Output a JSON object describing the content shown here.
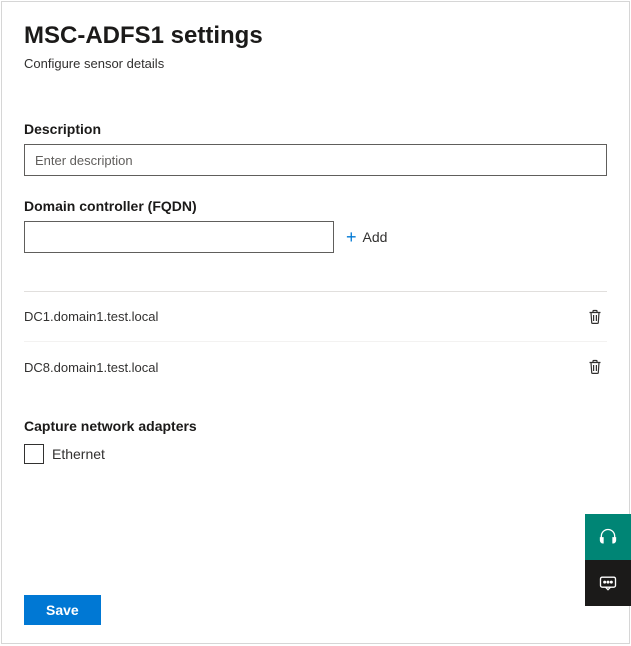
{
  "header": {
    "title": "MSC-ADFS1 settings",
    "subtitle": "Configure sensor details"
  },
  "description": {
    "label": "Description",
    "placeholder": "Enter description",
    "value": ""
  },
  "fqdn": {
    "label": "Domain controller (FQDN)",
    "value": "",
    "add_label": "Add"
  },
  "dc_list": [
    {
      "name": "DC1.domain1.test.local"
    },
    {
      "name": "DC8.domain1.test.local"
    }
  ],
  "adapters": {
    "label": "Capture network adapters",
    "items": [
      {
        "label": "Ethernet",
        "checked": false
      }
    ]
  },
  "actions": {
    "save": "Save"
  },
  "icons": {
    "plus": "+",
    "headset": "headset-icon",
    "chat": "chat-icon",
    "trash": "trash-icon"
  }
}
